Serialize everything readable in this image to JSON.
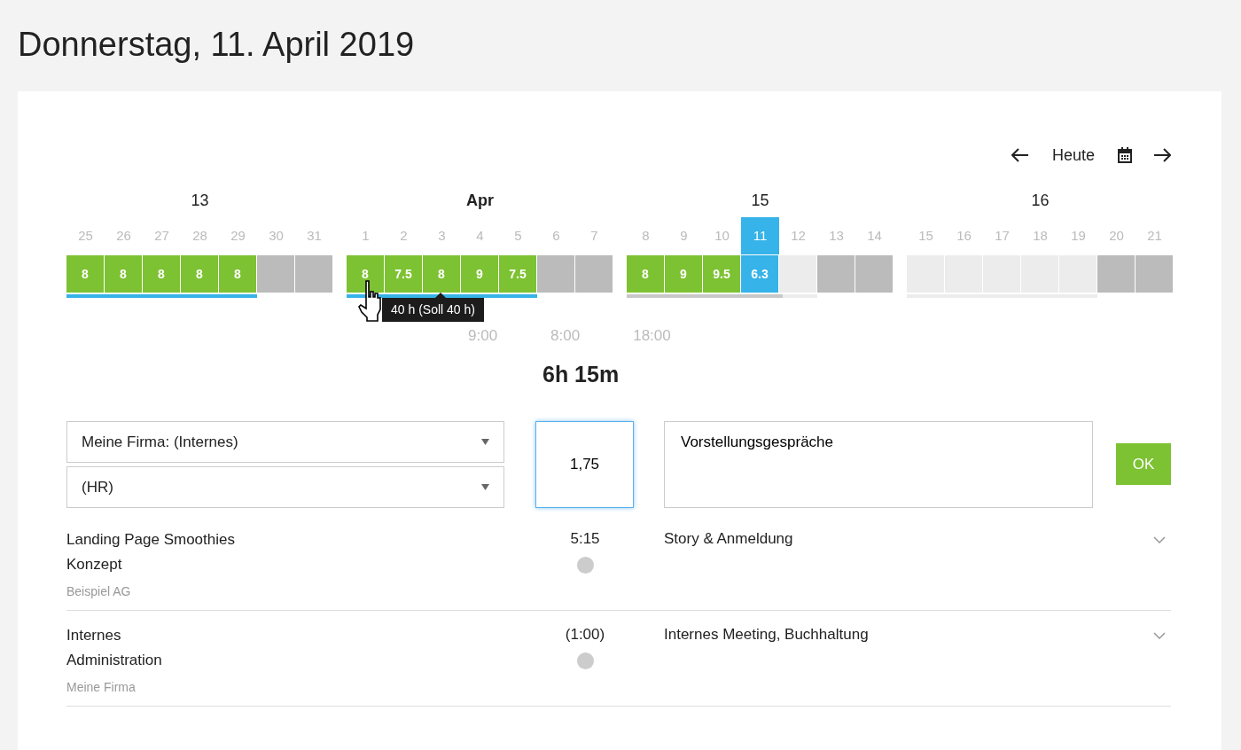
{
  "title": "Donnerstag, 11. April 2019",
  "nav": {
    "today": "Heute"
  },
  "weeks": [
    {
      "label": "13",
      "bold": false,
      "bar": {
        "level": 1,
        "complete": true
      },
      "days": [
        {
          "day": "25",
          "hours": "8",
          "kind": "done"
        },
        {
          "day": "26",
          "hours": "8",
          "kind": "done"
        },
        {
          "day": "27",
          "hours": "8",
          "kind": "done"
        },
        {
          "day": "28",
          "hours": "8",
          "kind": "done"
        },
        {
          "day": "29",
          "hours": "8",
          "kind": "done"
        },
        {
          "day": "30",
          "kind": "weekend"
        },
        {
          "day": "31",
          "kind": "weekend"
        }
      ]
    },
    {
      "label": "Apr",
      "bold": true,
      "bar": {
        "level": 1,
        "complete": true
      },
      "tooltip": "40 h (Soll 40 h)",
      "days": [
        {
          "day": "1",
          "hours": "8",
          "kind": "done"
        },
        {
          "day": "2",
          "hours": "7.5",
          "kind": "done"
        },
        {
          "day": "3",
          "hours": "8",
          "kind": "done"
        },
        {
          "day": "4",
          "hours": "9",
          "kind": "done"
        },
        {
          "day": "5",
          "hours": "7.5",
          "kind": "done"
        },
        {
          "day": "6",
          "kind": "weekend"
        },
        {
          "day": "7",
          "kind": "weekend"
        }
      ]
    },
    {
      "label": "15",
      "bold": false,
      "bar": {
        "level": 0.82,
        "complete": false
      },
      "days": [
        {
          "day": "8",
          "hours": "8",
          "kind": "done"
        },
        {
          "day": "9",
          "hours": "9",
          "kind": "done"
        },
        {
          "day": "10",
          "hours": "9.5",
          "kind": "done"
        },
        {
          "day": "11",
          "hours": "6.3",
          "kind": "today"
        },
        {
          "day": "12",
          "kind": "future"
        },
        {
          "day": "13",
          "kind": "weekend"
        },
        {
          "day": "14",
          "kind": "weekend"
        }
      ]
    },
    {
      "label": "16",
      "bold": false,
      "bar": {
        "level": 0
      },
      "days": [
        {
          "day": "15",
          "kind": "future"
        },
        {
          "day": "16",
          "kind": "future"
        },
        {
          "day": "17",
          "kind": "future"
        },
        {
          "day": "18",
          "kind": "future"
        },
        {
          "day": "19",
          "kind": "future"
        },
        {
          "day": "20",
          "kind": "weekend"
        },
        {
          "day": "21",
          "kind": "weekend"
        }
      ]
    }
  ],
  "times": [
    "9:00",
    "8:00",
    "18:00"
  ],
  "total": "6h 15m",
  "form": {
    "customer": "Meine Firma: (Internes)",
    "project": "(HR)",
    "hours": "1,75",
    "description": "Vorstellungsgespräche",
    "submit": "OK"
  },
  "entries": [
    {
      "project": [
        "Landing Page Smoothies",
        "Konzept"
      ],
      "client": "Beispiel AG",
      "time": "5:15",
      "description": "Story & Anmeldung"
    },
    {
      "project": [
        "Internes",
        "Administration"
      ],
      "client": "Meine Firma",
      "time": "(1:00)",
      "description": "Internes Meeting, Buchhaltung"
    }
  ]
}
